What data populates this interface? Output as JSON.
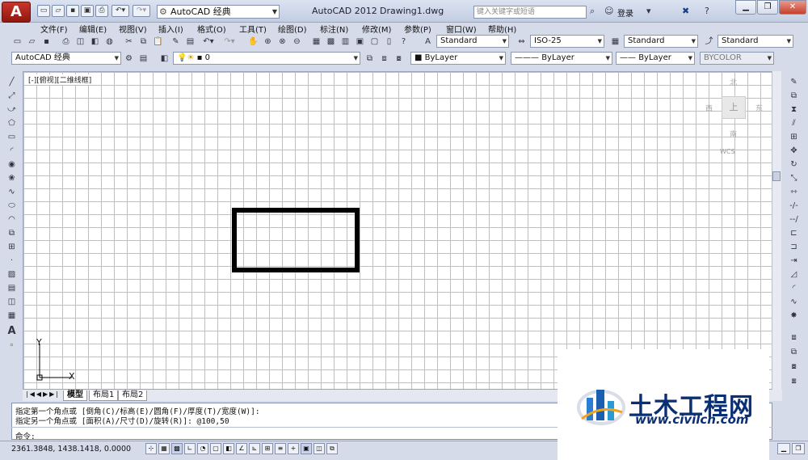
{
  "title_bar": {
    "app_logo": "A",
    "workspace": "AutoCAD 经典",
    "app_name": "AutoCAD 2012",
    "doc_name": "Drawing1.dwg",
    "search_placeholder": "键入关键字或短语",
    "login": "登录"
  },
  "menus": [
    "文件(F)",
    "编辑(E)",
    "视图(V)",
    "插入(I)",
    "格式(O)",
    "工具(T)",
    "绘图(D)",
    "标注(N)",
    "修改(M)",
    "参数(P)",
    "窗口(W)",
    "帮助(H)"
  ],
  "toolbar1": {
    "text_style": "Standard",
    "dim_style": "ISO-25",
    "table_style": "Standard",
    "multileader_style": "Standard"
  },
  "toolbar2": {
    "workspace": "AutoCAD 经典",
    "layer": "0",
    "color": "ByLayer",
    "linetype": "ByLayer",
    "lineweight": "ByLayer",
    "plotstyle": "BYCOLOR"
  },
  "viewport": {
    "label": "[-][俯视][二维线框]",
    "viewcube": {
      "north": "北",
      "south": "南",
      "east": "东",
      "west": "西",
      "top": "上",
      "wcs": "WCS"
    }
  },
  "ucs": {
    "x": "X",
    "y": "Y"
  },
  "tabs": [
    "模型",
    "布局1",
    "布局2"
  ],
  "command": {
    "line1": "指定第一个角点或 [倒角(C)/标高(E)/圆角(F)/厚度(T)/宽度(W)]:",
    "line2": "指定另一个角点或 [面积(A)/尺寸(D)/旋转(R)]: @100,50",
    "prompt": "命令:"
  },
  "status": {
    "coords": "2361.3848, 1438.1418, 0.0000"
  },
  "watermark": {
    "title": "土木工程网",
    "url": "www.civilcn.com"
  },
  "colors": {
    "brand": "#c9362a",
    "watermark": "#0a2f74",
    "grid": "#bfbfbf"
  }
}
